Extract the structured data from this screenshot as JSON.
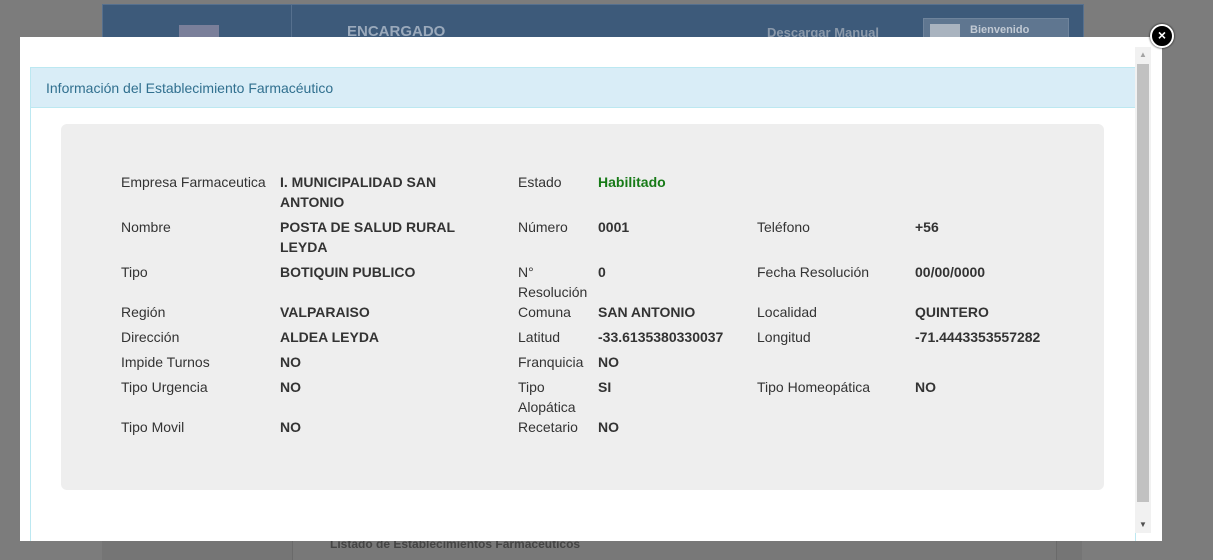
{
  "background": {
    "header_title": "ENCARGADO",
    "download_manual": "Descargar Manual",
    "welcome": "Bienvenido",
    "list_title": "Listado de Establecimientos Farmacéuticos"
  },
  "modal": {
    "close_icon": "×",
    "panel_title": "Información del Establecimiento Farmacéutico",
    "rows": [
      {
        "l1": "Empresa Farmaceutica",
        "v1": "I. MUNICIPALIDAD SAN ANTONIO",
        "l2": "Estado",
        "v2": "Habilitado",
        "l3": "",
        "v3": ""
      },
      {
        "l1": "Nombre",
        "v1": "POSTA DE SALUD RURAL LEYDA",
        "l2": "Número",
        "v2": "0001",
        "l3": "Teléfono",
        "v3": "+56"
      },
      {
        "l1": "Tipo",
        "v1": "BOTIQUIN PUBLICO",
        "l2": "N° Resolución",
        "v2": "0",
        "l3": "Fecha Resolución",
        "v3": "00/00/0000"
      },
      {
        "l1": "Región",
        "v1": "VALPARAISO",
        "l2": "Comuna",
        "v2": "SAN ANTONIO",
        "l3": "Localidad",
        "v3": "QUINTERO"
      },
      {
        "l1": "Dirección",
        "v1": "ALDEA LEYDA",
        "l2": "Latitud",
        "v2": "-33.6135380330037",
        "l3": "Longitud",
        "v3": "-71.4443353557282"
      },
      {
        "l1": "Impide Turnos",
        "v1": "NO",
        "l2": "Franquicia",
        "v2": "NO",
        "l3": "",
        "v3": ""
      },
      {
        "l1": "Tipo Urgencia",
        "v1": "NO",
        "l2": "Tipo Alopática",
        "v2": "SI",
        "l3": "Tipo Homeopática",
        "v3": "NO"
      },
      {
        "l1": "Tipo Movil",
        "v1": "NO",
        "l2": "Recetario",
        "v2": "NO",
        "l3": "",
        "v3": ""
      }
    ],
    "status_color": "#177a17"
  }
}
